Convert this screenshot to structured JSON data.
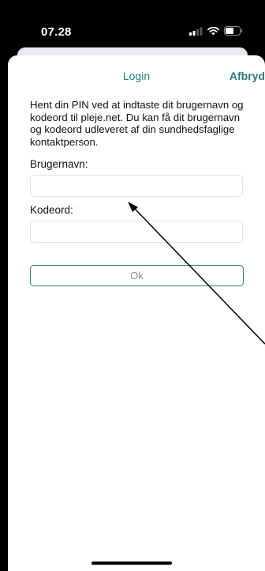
{
  "status_bar": {
    "time": "07.28",
    "icons": [
      "signal-icon",
      "wifi-icon",
      "battery-icon"
    ]
  },
  "nav": {
    "title": "Login",
    "cancel_label": "Afbryd"
  },
  "form": {
    "intro": "Hent din PIN ved at indtaste dit brugernavn og kodeord til pleje.net. Du kan få dit brugernavn og kodeord udleveret af din sundhedsfaglige kontaktperson.",
    "username_label": "Brugernavn:",
    "username_value": "",
    "password_label": "Kodeord:",
    "password_value": "",
    "ok_label": "Ok"
  },
  "colors": {
    "accent": "#2a7a7f",
    "button_text": "#8a8a8a"
  }
}
